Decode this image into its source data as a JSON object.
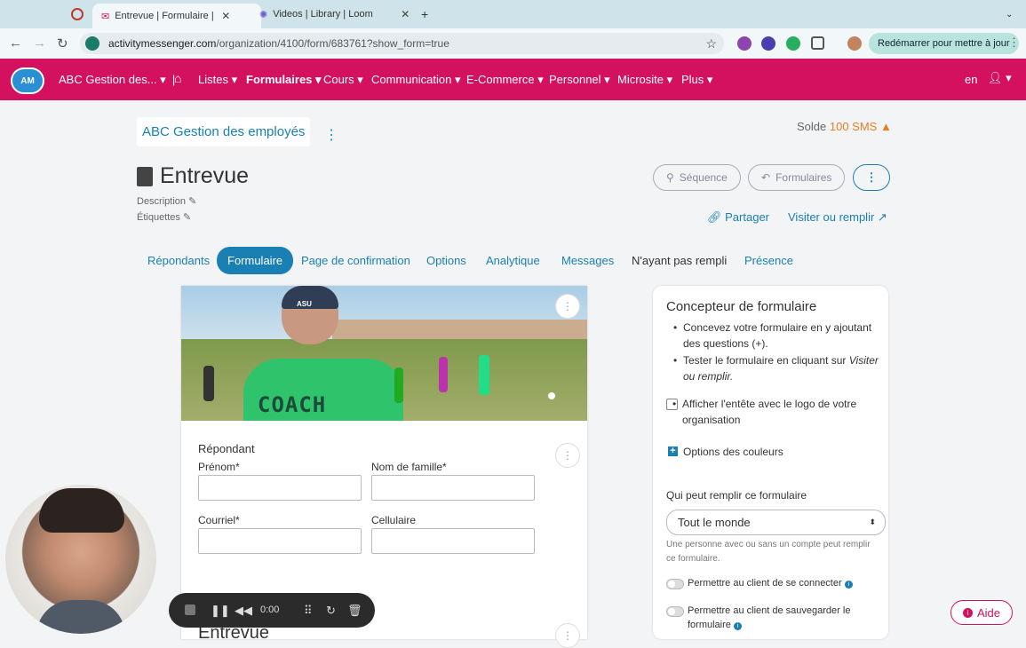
{
  "browser": {
    "tabs": [
      {
        "label": "Entrevue | Formulaire | AB"
      },
      {
        "label": "Videos | Library | Loom"
      }
    ],
    "url_domain": "activitymessenger.com",
    "url_path": "/organization/4100/form/683761?show_form=true",
    "update_button": "Redémarrer pour mettre à jour"
  },
  "appnav": {
    "logo": "AM",
    "org": "ABC Gestion des...",
    "items": [
      "Listes",
      "Formulaires",
      "Cours",
      "Communication",
      "E-Commerce",
      "Personnel",
      "Microsite",
      "Plus"
    ],
    "lang": "en"
  },
  "header": {
    "org_name": "ABC Gestion des employés",
    "solde_label": "Solde",
    "solde_amount": "100 SMS",
    "title": "Entrevue",
    "description": "Description",
    "etiquettes": "Étiquettes",
    "sequence_btn": "Séquence",
    "formulaires_btn": "Formulaires",
    "share": "Partager",
    "visit": "Visiter ou remplir"
  },
  "tabs": [
    "Répondants",
    "Formulaire",
    "Page de confirmation",
    "Options",
    "Analytique",
    "Messages",
    "N'ayant pas rempli",
    "Présence"
  ],
  "form": {
    "section": "Répondant",
    "fields": {
      "prenom": "Prénom*",
      "nom": "Nom de famille*",
      "courriel": "Courriel*",
      "cellulaire": "Cellulaire"
    },
    "next_section": "Entrevue",
    "hero_text": "COACH",
    "cap_text": "ASU"
  },
  "panel": {
    "title": "Concepteur de formulaire",
    "bullet1": "Concevez votre formulaire en y ajoutant des questions (+).",
    "bullet2_a": "Tester le formulaire en cliquant sur",
    "bullet2_b": "Visiter ou remplir.",
    "header_checkbox": "Afficher l'entête avec le logo de votre organisation",
    "color_options": "Options des couleurs",
    "who_label": "Qui peut remplir ce formulaire",
    "who_value": "Tout le monde",
    "who_help": "Une personne avec ou sans un compte peut remplir ce formulaire.",
    "toggle1": "Permettre au client de se connecter",
    "toggle2": "Permettre au client de sauvegarder le formulaire"
  },
  "aide": "Aide",
  "recorder": {
    "time": "0:00"
  }
}
